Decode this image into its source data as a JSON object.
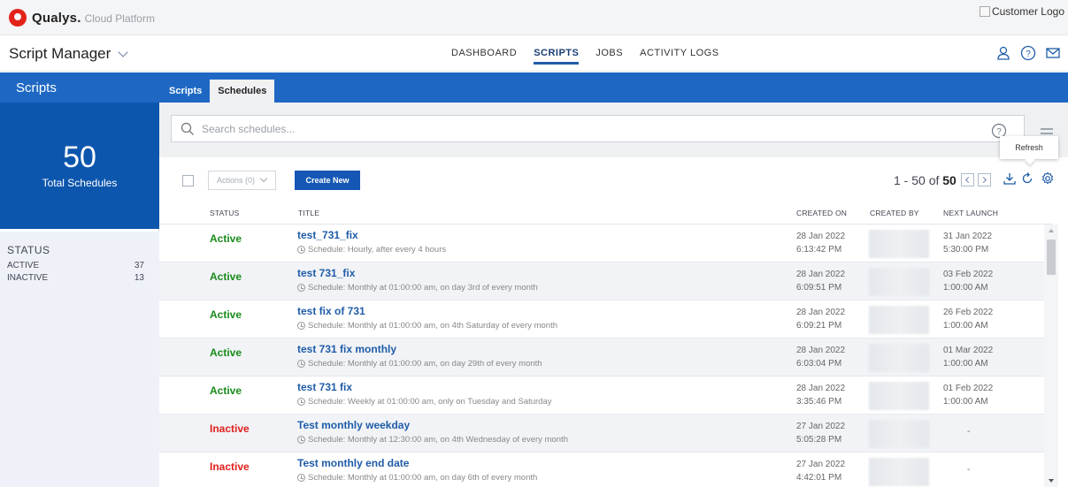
{
  "header": {
    "brand": "Qualys.",
    "brand_sub": "Cloud Platform",
    "customer_logo_alt": "Customer Logo"
  },
  "nav": {
    "app_name": "Script Manager",
    "links": [
      {
        "label": "DASHBOARD",
        "active": false
      },
      {
        "label": "SCRIPTS",
        "active": true
      },
      {
        "label": "JOBS",
        "active": false
      },
      {
        "label": "ACTIVITY LOGS",
        "active": false
      }
    ],
    "icons": [
      "user-icon",
      "help-icon",
      "mail-icon"
    ]
  },
  "sidebar": {
    "title": "Scripts",
    "total_count": "50",
    "total_label": "Total Schedules",
    "status_heading": "STATUS",
    "statuses": [
      {
        "label": "ACTIVE",
        "count": "37"
      },
      {
        "label": "INACTIVE",
        "count": "13"
      }
    ]
  },
  "tabs": [
    {
      "label": "Scripts",
      "active": false
    },
    {
      "label": "Schedules",
      "active": true
    }
  ],
  "search": {
    "placeholder": "Search schedules..."
  },
  "toolbar": {
    "actions_label": "Actions (0)",
    "create_label": "Create New",
    "pager_range": "1 - 50 of",
    "pager_total": "50",
    "tooltip": "Refresh"
  },
  "table": {
    "headers": {
      "status": "STATUS",
      "title": "TITLE",
      "created_on": "CREATED ON",
      "created_by": "CREATED BY",
      "next_launch": "NEXT LAUNCH"
    },
    "rows": [
      {
        "status": "Active",
        "title": "test_731_fix",
        "schedule": "Schedule: Hourly, after every 4 hours",
        "created_date": "28 Jan 2022",
        "created_time": "6:13:42 PM",
        "next_date": "31 Jan 2022",
        "next_time": "5:30:00 PM"
      },
      {
        "status": "Active",
        "title": "test 731_fix",
        "schedule": "Schedule: Monthly at 01:00:00 am, on day 3rd of every month",
        "created_date": "28 Jan 2022",
        "created_time": "6:09:51 PM",
        "next_date": "03 Feb 2022",
        "next_time": "1:00:00 AM"
      },
      {
        "status": "Active",
        "title": "test fix of 731",
        "schedule": "Schedule: Monthly at 01:00:00 am, on 4th Saturday of every month",
        "created_date": "28 Jan 2022",
        "created_time": "6:09:21 PM",
        "next_date": "26 Feb 2022",
        "next_time": "1:00:00 AM"
      },
      {
        "status": "Active",
        "title": "test 731 fix monthly",
        "schedule": "Schedule: Monthly at 01:00:00 am, on day 29th of every month",
        "created_date": "28 Jan 2022",
        "created_time": "6:03:04 PM",
        "next_date": "01 Mar 2022",
        "next_time": "1:00:00 AM"
      },
      {
        "status": "Active",
        "title": "test 731 fix",
        "schedule": "Schedule: Weekly at 01:00:00 am, only on Tuesday and Saturday",
        "created_date": "28 Jan 2022",
        "created_time": "3:35:46 PM",
        "next_date": "01 Feb 2022",
        "next_time": "1:00:00 AM"
      },
      {
        "status": "Inactive",
        "title": "Test monthly weekday",
        "schedule": "Schedule: Monthly at 12:30:00 am, on 4th Wednesday of every month",
        "created_date": "27 Jan 2022",
        "created_time": "5:05:28 PM",
        "next_date": "-",
        "next_time": ""
      },
      {
        "status": "Inactive",
        "title": "Test monthly end date",
        "schedule": "Schedule: Monthly at 01:00:00 am, on day 6th of every month",
        "created_date": "27 Jan 2022",
        "created_time": "4:42:01 PM",
        "next_date": "-",
        "next_time": ""
      }
    ]
  },
  "colors": {
    "active": "#1a8a1a",
    "inactive": "#e0201b",
    "primary": "#1e68c4",
    "sidebar_total": "#0d56ad"
  }
}
